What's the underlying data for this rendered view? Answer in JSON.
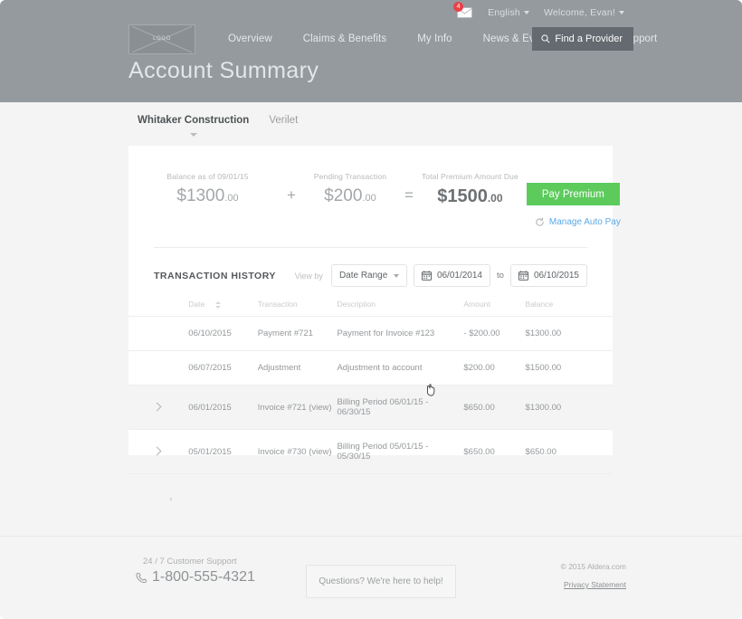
{
  "header": {
    "logo_text": "LOGO",
    "notification_count": "4",
    "language": "English",
    "welcome": "Welcome, Evan!",
    "nav": [
      {
        "label": "Overview"
      },
      {
        "label": "Claims & Benefits"
      },
      {
        "label": "My Info"
      },
      {
        "label": "News & Events"
      },
      {
        "label": "Help & Support"
      }
    ],
    "find_provider": "Find a Provider",
    "page_title": "Account Summary"
  },
  "tabs": [
    {
      "label": "Whitaker Construction",
      "active": true
    },
    {
      "label": "Verilet",
      "active": false
    }
  ],
  "summary": {
    "balance_label": "Balance as of 09/01/15",
    "balance_dollars": "$1300",
    "balance_cents": ".00",
    "operator_plus": "+",
    "pending_label": "Pending Transaction",
    "pending_dollars": "$200",
    "pending_cents": ".00",
    "operator_equals": "=",
    "total_label": "Total Premium Amount Due",
    "total_dollars": "$1500",
    "total_cents": ".00",
    "pay_button": "Pay Premium",
    "manage_autopay": "Manage Auto Pay"
  },
  "transaction_history": {
    "title": "TRANSACTION HISTORY",
    "view_by_label": "View by",
    "view_by_value": "Date Range",
    "date_from": "06/01/2014",
    "to_label": "to",
    "date_to": "06/10/2015",
    "columns": [
      "Date",
      "Transaction",
      "Description",
      "Amount",
      "Balance"
    ],
    "rows": [
      {
        "expandable": false,
        "highlighted": false,
        "date": "06/10/2015",
        "transaction": "Payment #721",
        "transaction_link": false,
        "description": "Payment for Invoice #123",
        "amount": "- $200.00",
        "balance": "$1300.00"
      },
      {
        "expandable": false,
        "highlighted": false,
        "date": "06/07/2015",
        "transaction": "Adjustment",
        "transaction_link": false,
        "description": "Adjustment to account",
        "amount": "$200.00",
        "balance": "$1500.00"
      },
      {
        "expandable": true,
        "highlighted": true,
        "date": "06/01/2015",
        "transaction": "Invoice #721 (view)",
        "transaction_link": true,
        "description": "Billing Period 06/01/15 - 06/30/15",
        "amount": "$650.00",
        "balance": "$1300.00"
      },
      {
        "expandable": true,
        "highlighted": false,
        "date": "05/01/2015",
        "transaction": "Invoice #730 (view)",
        "transaction_link": true,
        "description": "Billing Period 05/01/15 - 05/30/15",
        "amount": "$650.00",
        "balance": "$650.00"
      }
    ]
  },
  "footer": {
    "support_label": "24 / 7 Customer Support",
    "phone": "1-800-555-4321",
    "help_text": "Questions? We're here to help!",
    "copyright": "© 2015 Aldera.com",
    "privacy": "Privacy Statement"
  },
  "colors": {
    "header_bg": "#959a9e",
    "accent_green": "#5ccb5c",
    "link_blue": "#5aa9e6",
    "badge_red": "#e8414a",
    "page_bg": "#f4f4f4"
  }
}
